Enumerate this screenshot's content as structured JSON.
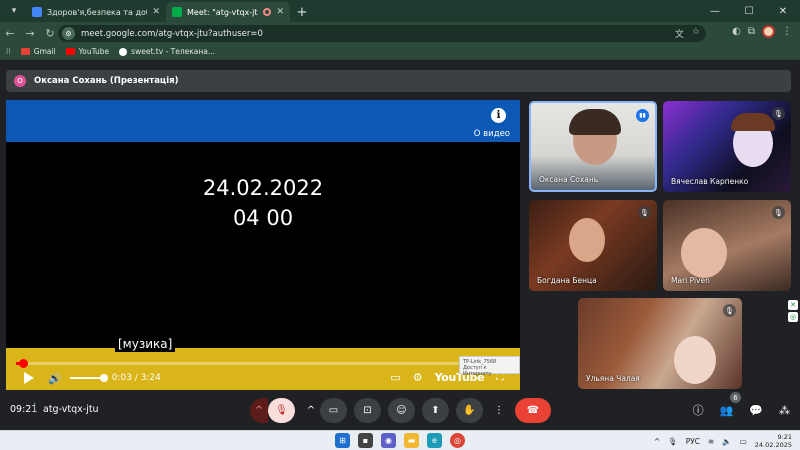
{
  "browser": {
    "tabs": [
      {
        "title": "Здоров'я,безпека та добробут",
        "favicon_color": "#4285f4"
      },
      {
        "title": "Meet: \"atg-vtqx-jtu\"",
        "favicon_color": "#00ac47",
        "active": true
      }
    ],
    "address": "meet.google.com/atg-vtqx-jtu?authuser=0",
    "bookmarks": [
      {
        "label": "Gmail",
        "icon_color": "#ea4335"
      },
      {
        "label": "YouTube",
        "icon_color": "#ff0000"
      },
      {
        "label": "sweet.tv - Телекана...",
        "icon_color": "#ffffff"
      }
    ]
  },
  "meet": {
    "presenter_initial": "О",
    "presenter_label": "Оксана Сохань (Презентація)",
    "player": {
      "info_label": "О видео",
      "date": "24.02.2022",
      "time": "04 00",
      "subtitle": "[музика]",
      "current_time": "0:03",
      "duration": "3:24",
      "time_display": "0:03 / 3:24",
      "progress_fraction": 0.015,
      "brand": "YouTube",
      "wifi_tooltip_line1": "TP-Link_7568",
      "wifi_tooltip_line2": "Доступ к Интернету"
    },
    "participants": [
      {
        "name": "Оксана Сохань",
        "speaking": true
      },
      {
        "name": "Вячеслав Карпенко",
        "muted": true
      },
      {
        "name": "Богдана Бенца",
        "muted": true
      },
      {
        "name": "Mari Piven",
        "muted": true
      },
      {
        "name": "Ульяна Чалая",
        "muted": true
      }
    ],
    "bottom_bar": {
      "clock": "09:21",
      "separator": "|",
      "meeting_code": "atg-vtqx-jtu",
      "people_count": "6"
    }
  },
  "taskbar": {
    "lang": "РУС",
    "time": "9:21",
    "date": "24.02.2025"
  }
}
